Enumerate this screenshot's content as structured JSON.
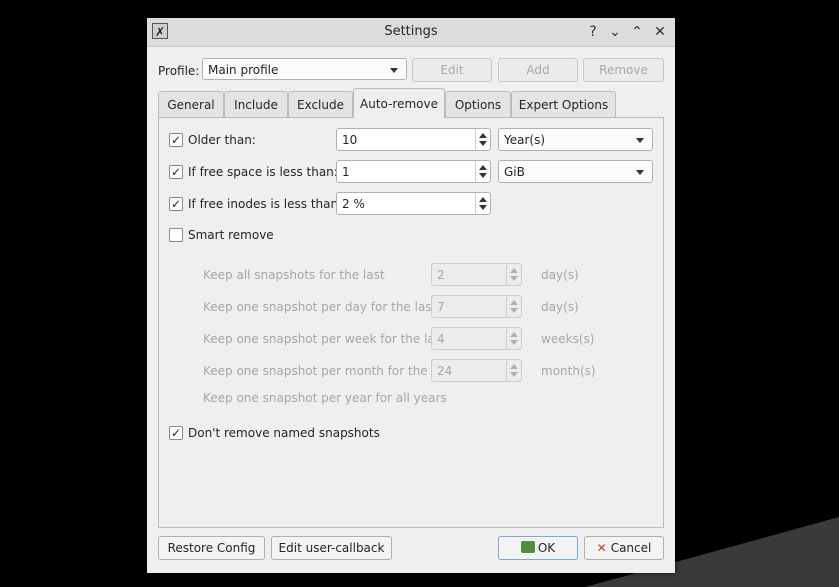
{
  "window": {
    "title": "Settings",
    "help_glyph": "?",
    "minimize_glyph": "⌄",
    "maximize_glyph": "⌃",
    "close_glyph": "✕",
    "app_icon_glyph": "✗"
  },
  "profile": {
    "label": "Profile:",
    "selected": "Main profile",
    "edit": "Edit",
    "add": "Add",
    "remove": "Remove"
  },
  "tabs": [
    "General",
    "Include",
    "Exclude",
    "Auto-remove",
    "Options",
    "Expert Options"
  ],
  "active_tab": "Auto-remove",
  "auto_remove": {
    "older_than": {
      "label": "Older than:",
      "checked": true,
      "value": "10",
      "unit": "Year(s)"
    },
    "free_space": {
      "label": "If free space is less than:",
      "checked": true,
      "value": "1",
      "unit": "GiB"
    },
    "free_inodes": {
      "label": "If free inodes is less than:",
      "checked": true,
      "value": "2 %"
    },
    "smart_remove": {
      "label": "Smart remove",
      "checked": false,
      "all_last": {
        "label": "Keep all snapshots for the last",
        "value": "2",
        "unit": "day(s)"
      },
      "per_day": {
        "label": "Keep one snapshot per day for the last",
        "value": "7",
        "unit": "day(s)"
      },
      "per_week": {
        "label": "Keep one snapshot per week for the last",
        "value": "4",
        "unit": "weeks(s)"
      },
      "per_month": {
        "label": "Keep one snapshot per month for the last",
        "value": "24",
        "unit": "month(s)"
      },
      "per_year": {
        "label": "Keep one snapshot per year for all years"
      }
    },
    "dont_remove_named": {
      "label": "Don't remove named snapshots",
      "checked": true
    }
  },
  "footer": {
    "restore_config": "Restore Config",
    "edit_user_callback": "Edit user-callback",
    "ok": "OK",
    "cancel": "Cancel"
  },
  "check_glyph": "✓"
}
